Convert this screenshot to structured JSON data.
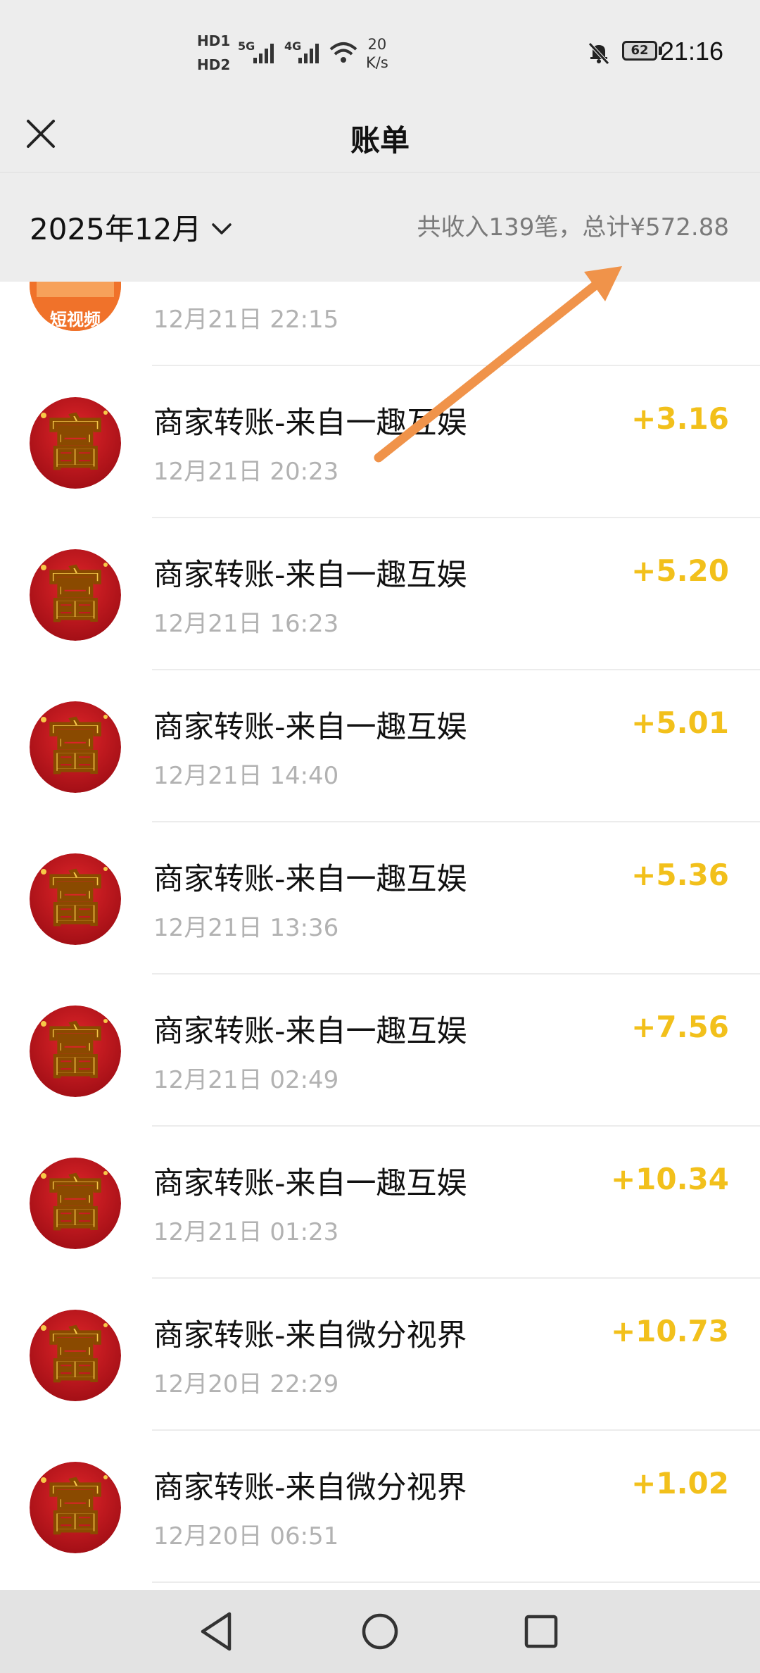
{
  "status_bar": {
    "hd1": "HD1",
    "hd2": "HD2",
    "net_5g": "5G",
    "net_4g": "4G",
    "speed_value": "20",
    "speed_unit": "K/s",
    "battery": "62",
    "time": "21:16",
    "icons": [
      "signal-icon",
      "wifi-icon",
      "bell-muted-icon",
      "battery-icon"
    ]
  },
  "header": {
    "title": "账单",
    "close_icon": "close-icon"
  },
  "filter": {
    "month": "2025年12月",
    "summary": "共收入139笔，总计¥572.88"
  },
  "partial_item": {
    "time": "12月21日 22:15",
    "avatar_text": "短视频"
  },
  "transactions": [
    {
      "title": "商家转账-来自一趣互娱",
      "time": "12月21日 20:23",
      "amount": "+3.16"
    },
    {
      "title": "商家转账-来自一趣互娱",
      "time": "12月21日 16:23",
      "amount": "+5.20"
    },
    {
      "title": "商家转账-来自一趣互娱",
      "time": "12月21日 14:40",
      "amount": "+5.01"
    },
    {
      "title": "商家转账-来自一趣互娱",
      "time": "12月21日 13:36",
      "amount": "+5.36"
    },
    {
      "title": "商家转账-来自一趣互娱",
      "time": "12月21日 02:49",
      "amount": "+7.56"
    },
    {
      "title": "商家转账-来自一趣互娱",
      "time": "12月21日 01:23",
      "amount": "+10.34"
    },
    {
      "title": "商家转账-来自微分视界",
      "time": "12月20日 22:29",
      "amount": "+10.73"
    },
    {
      "title": "商家转账-来自微分视界",
      "time": "12月20日 06:51",
      "amount": "+1.02"
    }
  ],
  "avatar_glyph": "富",
  "colors": {
    "amount": "#f2c01b",
    "arrow": "#f0934a",
    "background": "#ededed"
  }
}
